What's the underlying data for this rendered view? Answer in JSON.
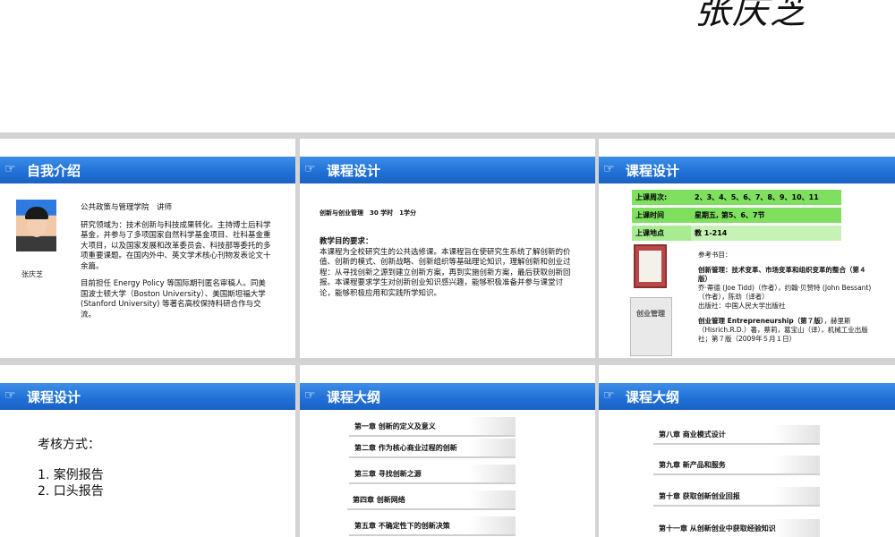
{
  "top": {
    "title": "张庆芝"
  },
  "slides": {
    "intro": {
      "title": "自我介绍",
      "name": "张庆芝",
      "paragraphs": [
        "公共政策与管理学院　讲师",
        "研究领域为：技术创新与科技成果转化。主持博士后科学基金，并参与了多项国家自然科学基金项目、社科基金重大项目，以及国家发展和改革委员会、科技部等委托的多项重要课题。在国内外中、英文学术核心刊物发表论文十余篇。",
        "目前担任 Energy Policy 等国际期刊匿名审稿人。同美国波士顿大学（Boston University）、美国斯坦福大学 (Stanford University) 等著名高校保持科研合作与交流。"
      ]
    },
    "design1": {
      "title": "课程设计",
      "course": "创新与创业管理　30 学时　1学分",
      "req_title": "教学目的要求：",
      "req_text": "本课程为全校研究生的公共选修课。本课程旨在使研究生系统了解创新的价值、创新的模式、创新战略、创新组织等基础理论知识，理解创新和创业过程：从寻找创新之源到建立创新方案，再到实施创新方案，最后获取创新回报。本课程要求学生对创新创业知识感兴趣，能够积极准备并参与课堂讨论，能够积极应用和实践所学知识。"
    },
    "design2": {
      "title": "课程设计",
      "schedule": [
        {
          "label": "上课周次:",
          "value": "2、3、4、5、6、7、8、9、10、11"
        },
        {
          "label": "上课时间",
          "value": "星期五, 第5、6、7节"
        },
        {
          "label": "上课地点",
          "value": "教 1-214"
        }
      ],
      "book2_cover": "创业管理",
      "refs_title": "参考书目：",
      "ref1_title": "创新管理：技术变革、市场变革和组织变革的整合（第４版）",
      "ref1_author": "乔·蒂德 (Joe Tidd)（作者），约翰·贝赞特 (John Bessant)（作者），陈劲（译者）",
      "ref1_pub": "出版社：中国人民大学出版社",
      "ref2_title": "创业管理 Entrepreneurship（第７版）",
      "ref2_rest": "，赫里斯（Hisrich.R.D.）著，蔡莉，葛宝山（译），机械工业出版社；第７版（2009年５月１日）"
    },
    "design3": {
      "title": "课程设计",
      "exam_label": "考核方式：",
      "items": [
        "1. 案例报告",
        "2. 口头报告"
      ]
    },
    "outline1": {
      "title": "课程大纲",
      "chapters": [
        "第一章 创新的定义及意义",
        "第二章 作为核心商业过程的创新",
        "第三章 寻找创新之源",
        "第四章 创新网络",
        "第五章 不确定性下的创新决策"
      ]
    },
    "outline2": {
      "title": "课程大纲",
      "chapters": [
        "第八章 商业模式设计",
        "第九章 新产品和服务",
        "第十章 获取创新创业回报",
        "第十一章 从创新创业中获取经验知识"
      ]
    }
  }
}
